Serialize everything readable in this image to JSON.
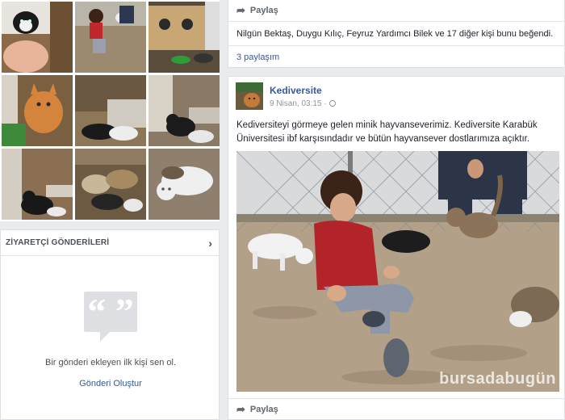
{
  "photos": {
    "icons": [
      "kitten-photo",
      "child-with-cats-photo",
      "cat-shelter-photo",
      "orange-cat-photo",
      "cats-sleeping-photo",
      "black-cat-photo",
      "black-cat-with-kitten-photo",
      "cats-in-shelter-photo",
      "white-cat-photo"
    ]
  },
  "visitor_posts": {
    "title": "ZİYARETÇİ GÖNDERİLERİ",
    "chevron_icon": "chevron-right-icon",
    "empty_text": "Bir gönderi ekleyen ilk kişi sen ol.",
    "create_link": "Gönderi Oluştur",
    "quote_icon": "quote-icon"
  },
  "prev_post": {
    "share_label": "Paylaş",
    "likes_text": "Nilgün Bektaş, Duygu Kılıç, Feyruz Yardımcı Bilek ve 17 diğer kişi bunu beğendi.",
    "shares_text": "3 paylaşım"
  },
  "post": {
    "page_name": "Kediversite",
    "timestamp": "9 Nisan, 03:15 ·",
    "text": "Kediversiteyi görmeye gelen minik hayvanseverimiz. Kediversite Karabük Üniversitesi ibf karşısındadır ve bütün hayvansever dostlarımıza açıktır.",
    "watermark": "bursadabugün",
    "share_label": "Paylaş"
  },
  "colors": {
    "link": "#365899",
    "background": "#e9ebee",
    "card": "#ffffff"
  }
}
